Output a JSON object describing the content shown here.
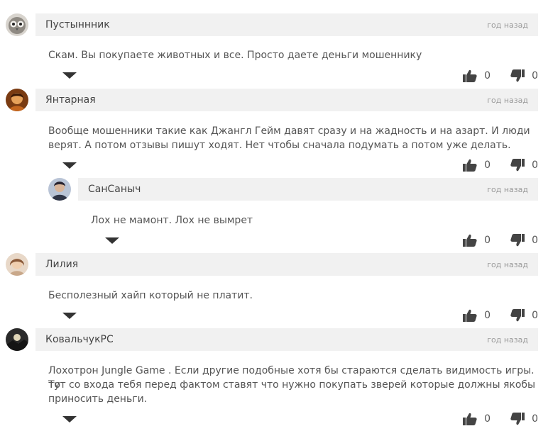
{
  "comments": [
    {
      "author": "Пустыннник",
      "time": "год назад",
      "text": "Скам. Вы покупаете животных и все. Просто даете деньги мошеннику",
      "likes": "0",
      "dislikes": "0",
      "avatar": "avatar-owl"
    },
    {
      "author": "Янтарная",
      "time": "год назад",
      "text_line1": "Вообще мошенники такие как Джангл Гейм давят сразу и на жадность и на азарт. И люди",
      "text_line2": "верят. А потом отзывы пишут ходят. Нет чтобы сначала подумать а потом уже делать.",
      "likes": "0",
      "dislikes": "0",
      "avatar": "avatar-woman-warm"
    },
    {
      "author": "СанСаныч",
      "time": "год назад",
      "text": "Лох не мамонт. Лох не вымрет",
      "likes": "0",
      "dislikes": "0",
      "avatar": "avatar-person-dark"
    },
    {
      "author": "Лилия",
      "time": "год назад",
      "text": "Бесполезный хайп который не платит.",
      "likes": "0",
      "dislikes": "0",
      "avatar": "avatar-woman-light"
    },
    {
      "author": "КовальчукРС",
      "time": "год назад",
      "text_line1": "Лохотрон Jungle Game . Если другие подобные хотя бы стараются сделать видимость игры. То",
      "text_line2": "тут со входа тебя перед фактом ставят что нужно покупать зверей которые должны якобы",
      "text_line3": "приносить деньги.",
      "likes": "0",
      "dislikes": "0",
      "avatar": "avatar-landscape"
    }
  ]
}
